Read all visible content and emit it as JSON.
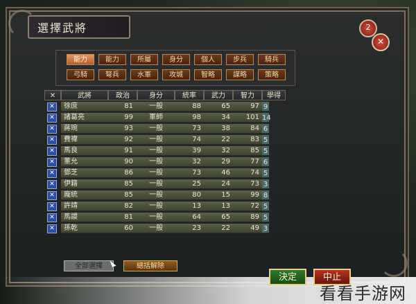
{
  "title": "選擇武將",
  "top_buttons": {
    "help": "2",
    "close": "✕"
  },
  "filters": [
    {
      "label": "能力",
      "selected": true
    },
    {
      "label": "能力",
      "selected": false
    },
    {
      "label": "所屬",
      "selected": false
    },
    {
      "label": "身分",
      "selected": false
    },
    {
      "label": "個人",
      "selected": false
    },
    {
      "label": "步兵",
      "selected": false
    },
    {
      "label": "騎兵",
      "selected": false
    },
    {
      "label": "弓騎",
      "selected": false
    },
    {
      "label": "弩兵",
      "selected": false
    },
    {
      "label": "水軍",
      "selected": false
    },
    {
      "label": "攻城",
      "selected": false
    },
    {
      "label": "智略",
      "selected": false
    },
    {
      "label": "謀略",
      "selected": false
    },
    {
      "label": "策略",
      "selected": false
    }
  ],
  "table": {
    "headers": [
      "✕",
      "武將",
      "政治",
      "身分",
      "統率",
      "武力",
      "智力",
      "學得"
    ],
    "rows": [
      {
        "name": "徐庶",
        "pol": "81",
        "rank": "一般",
        "lead": "88",
        "war": "65",
        "int": "97",
        "learn": "9"
      },
      {
        "name": "諸葛亮",
        "pol": "99",
        "rank": "軍師",
        "lead": "98",
        "war": "34",
        "int": "101",
        "learn": "14"
      },
      {
        "name": "蔣琬",
        "pol": "93",
        "rank": "一般",
        "lead": "73",
        "war": "38",
        "int": "84",
        "learn": "6"
      },
      {
        "name": "費禕",
        "pol": "92",
        "rank": "一般",
        "lead": "74",
        "war": "22",
        "int": "83",
        "learn": "5"
      },
      {
        "name": "馬良",
        "pol": "91",
        "rank": "一般",
        "lead": "39",
        "war": "32",
        "int": "85",
        "learn": "5"
      },
      {
        "name": "董允",
        "pol": "90",
        "rank": "一般",
        "lead": "32",
        "war": "29",
        "int": "77",
        "learn": "6"
      },
      {
        "name": "鄧芝",
        "pol": "86",
        "rank": "一般",
        "lead": "73",
        "war": "46",
        "int": "74",
        "learn": "5"
      },
      {
        "name": "伊籍",
        "pol": "85",
        "rank": "一般",
        "lead": "25",
        "war": "24",
        "int": "73",
        "learn": "3"
      },
      {
        "name": "龐統",
        "pol": "85",
        "rank": "一般",
        "lead": "80",
        "war": "15",
        "int": "99",
        "learn": "8"
      },
      {
        "name": "許靖",
        "pol": "82",
        "rank": "一般",
        "lead": "13",
        "war": "13",
        "int": "72",
        "learn": "5"
      },
      {
        "name": "馬謖",
        "pol": "81",
        "rank": "一般",
        "lead": "64",
        "war": "65",
        "int": "89",
        "learn": "5"
      },
      {
        "name": "孫乾",
        "pol": "60",
        "rank": "一般",
        "lead": "23",
        "war": "22",
        "int": "49",
        "learn": "3"
      }
    ]
  },
  "bottom": {
    "select_all": "全部選擇",
    "clear_all": "總括解除",
    "decide": "決定",
    "abort": "中止"
  },
  "watermark": "看看手游网"
}
